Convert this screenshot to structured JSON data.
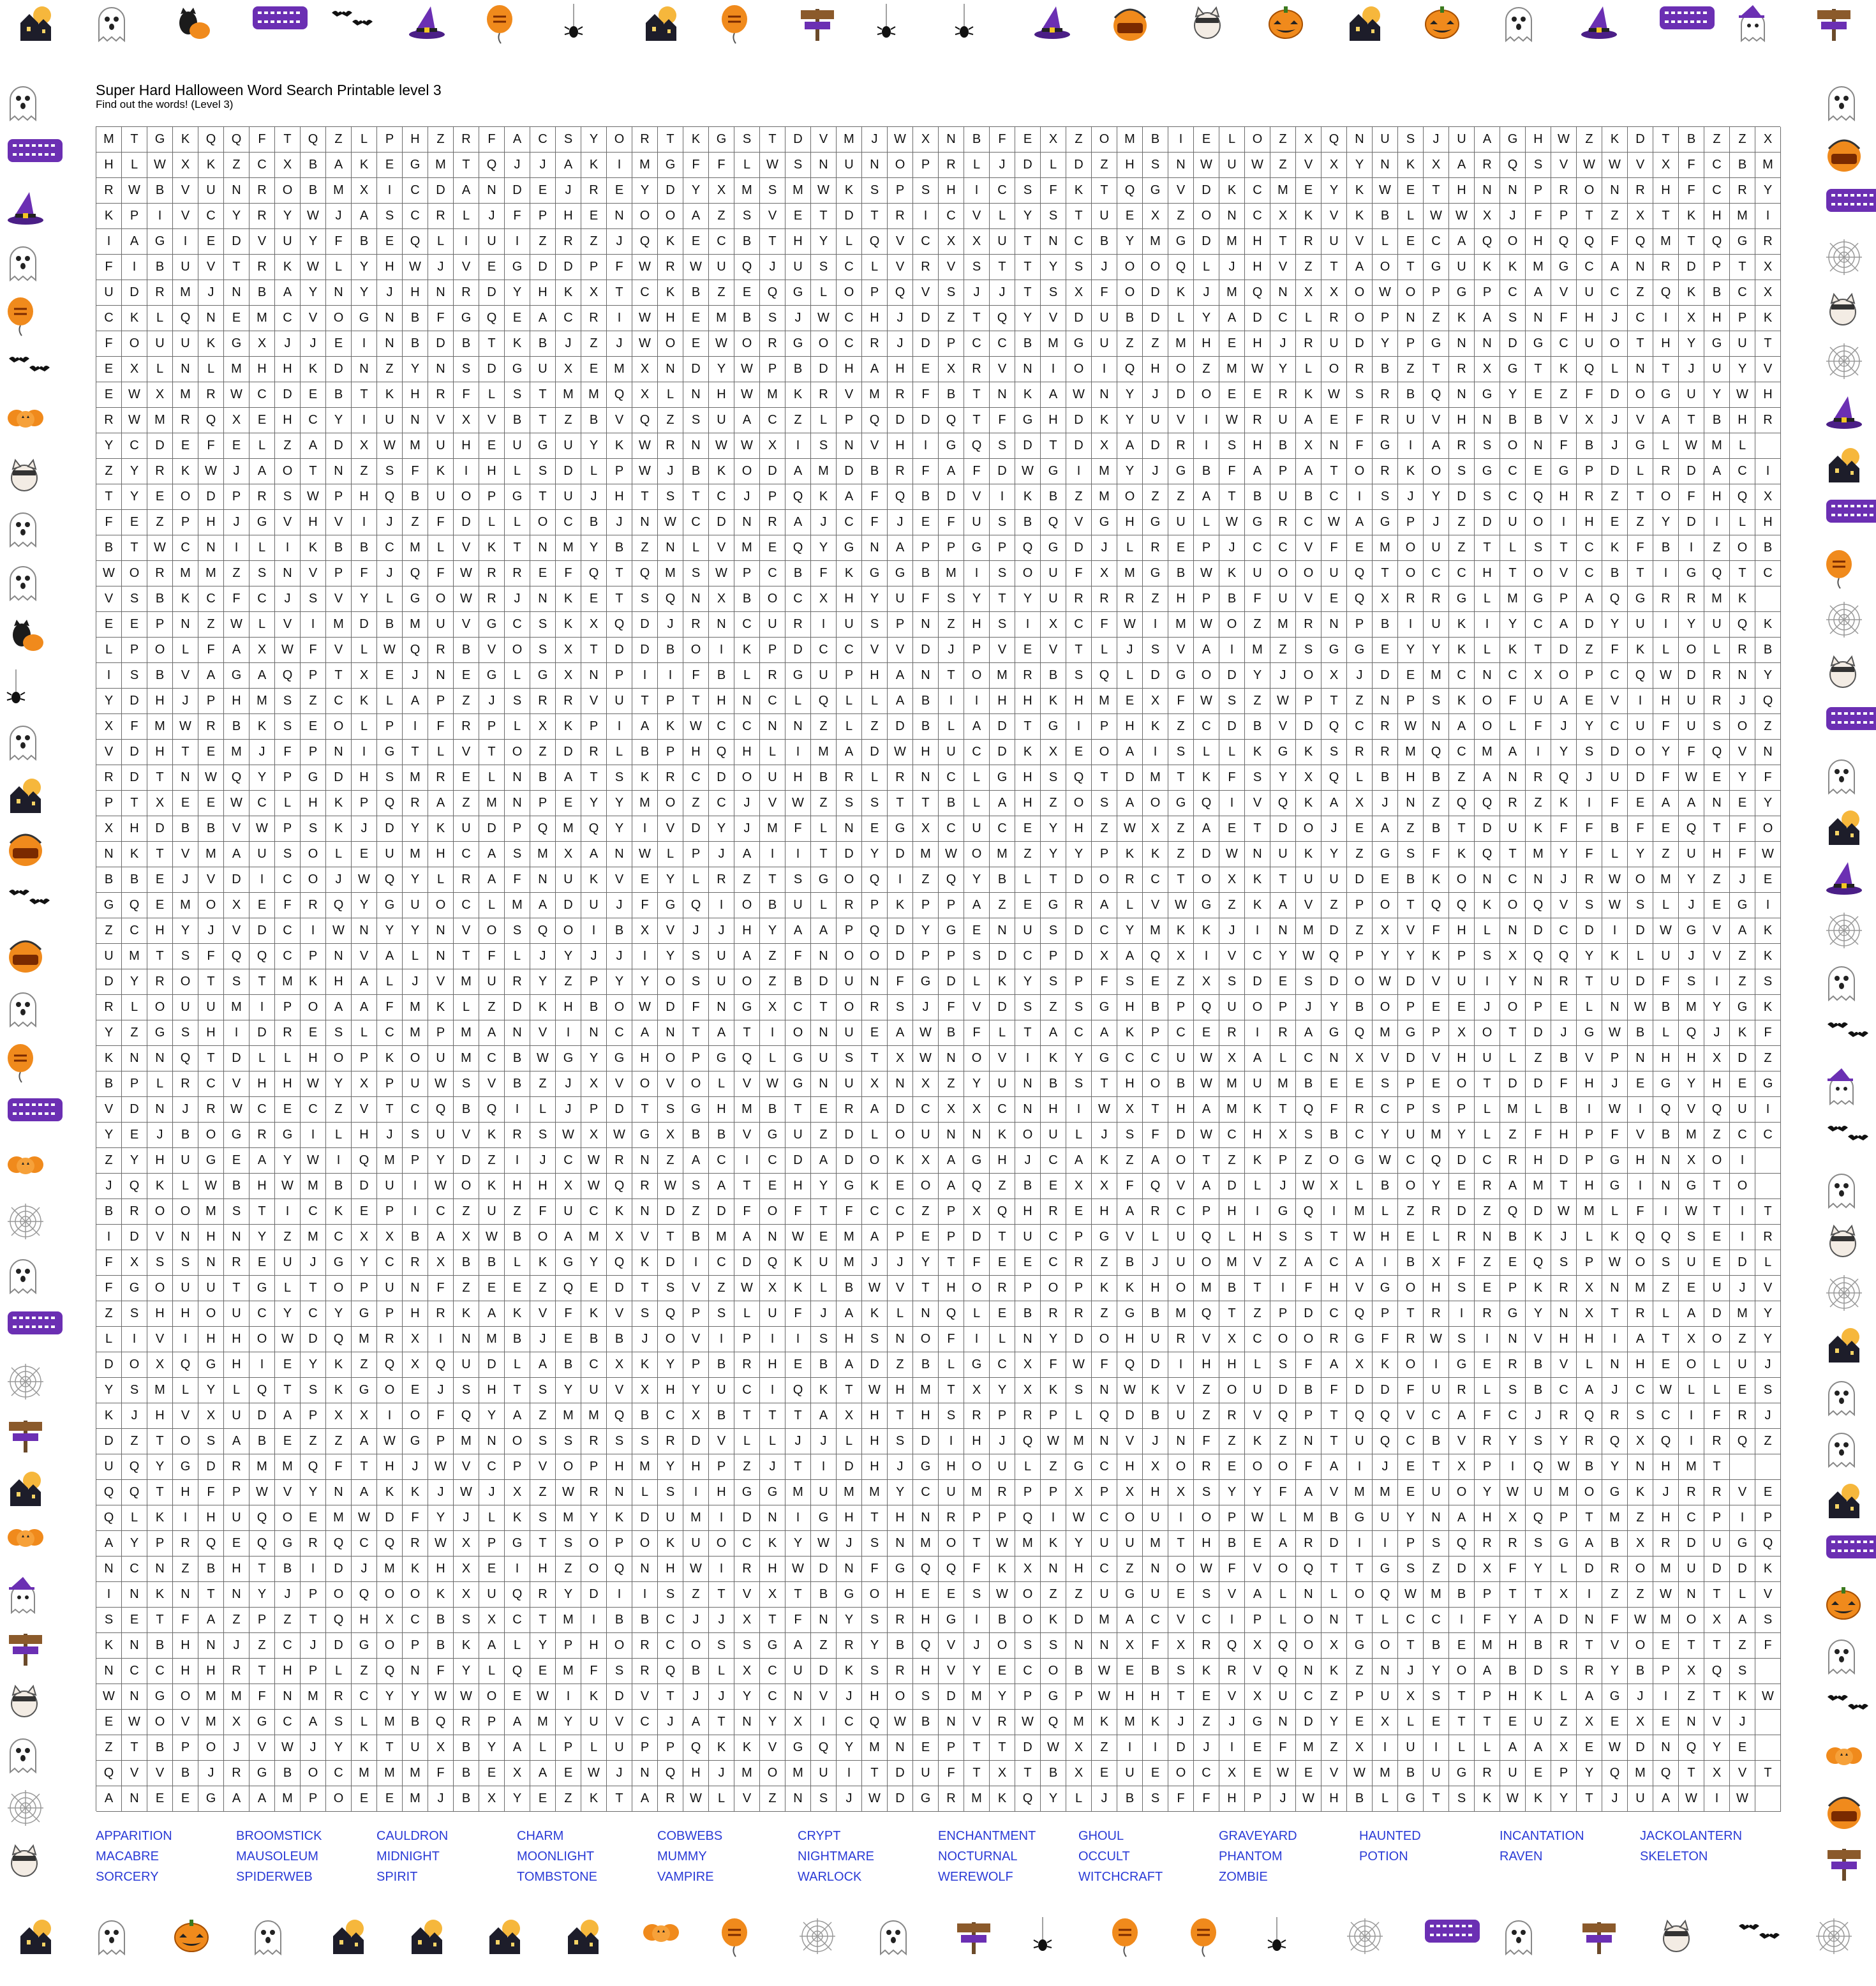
{
  "title": "Super Hard Halloween Word Search Printable level 3",
  "subtitle": "Find out the words! (Level 3)",
  "colors": {
    "word_list": "#2b3bd6",
    "grid_line": "#6a6a6a",
    "purple": "#6b2fb3",
    "orange": "#f08a1c"
  },
  "decorations": {
    "top": [
      "haunted-house-icon",
      "ghost-icon",
      "black-cat-pumpkin-icon",
      "happy-halloween-sign-icon",
      "bats-icon",
      "witch-hat-icon",
      "trick-or-treat-balloon-icon",
      "spider-icon",
      "haunted-house-icon",
      "trick-or-treat-balloon-icon",
      "halloween-signpost-icon",
      "spider-icon",
      "spider-icon",
      "witch-hat-icon",
      "trick-or-treat-bucket-icon",
      "cat-icon",
      "pumpkin-icon",
      "haunted-house-icon",
      "pumpkin-icon",
      "ghost-icon",
      "witch-hat-icon",
      "happy-halloween-sign-icon",
      "witch-ghost-icon",
      "halloween-signpost-icon"
    ],
    "bottom": [
      "haunted-house-icon",
      "ghost-icon",
      "pumpkin-icon",
      "ghost-icon",
      "haunted-house-icon",
      "haunted-house-icon",
      "haunted-house-icon",
      "haunted-house-icon",
      "pumpkins-icon",
      "trick-or-treat-balloon-icon",
      "spiderweb-icon",
      "ghost-icon",
      "halloween-signpost-icon",
      "spider-icon",
      "trick-or-treat-balloon-icon",
      "trick-or-treat-balloon-icon",
      "spider-icon",
      "spiderweb-icon",
      "happy-halloween-sign-icon",
      "ghost-icon",
      "halloween-signpost-icon",
      "cat-icon",
      "bats-icon",
      "spiderweb-icon"
    ],
    "left": [
      "ghost-icon",
      "happy-halloween-sign-icon",
      "witch-hat-icon",
      "ghost-icon",
      "trick-or-treat-balloon-icon",
      "bats-icon",
      "pumpkins-icon",
      "cat-icon",
      "ghost-icon",
      "ghost-icon",
      "black-cat-pumpkin-icon",
      "spider-icon",
      "ghost-icon",
      "haunted-house-icon",
      "trick-or-treat-bucket-icon",
      "bats-icon",
      "trick-or-treat-bucket-icon",
      "ghost-icon",
      "trick-or-treat-balloon-icon",
      "happy-halloween-sign-icon",
      "pumpkins-icon",
      "spiderweb-icon",
      "ghost-icon",
      "happy-halloween-sign-icon",
      "spiderweb-icon",
      "halloween-signpost-icon",
      "haunted-house-icon",
      "pumpkins-icon",
      "witch-ghost-icon",
      "halloween-signpost-icon",
      "cat-icon",
      "ghost-icon",
      "spiderweb-icon",
      "cat-icon"
    ],
    "right": [
      "ghost-icon",
      "trick-or-treat-bucket-icon",
      "happy-halloween-sign-icon",
      "spiderweb-icon",
      "cat-icon",
      "spiderweb-icon",
      "witch-hat-icon",
      "haunted-house-icon",
      "happy-halloween-sign-icon",
      "trick-or-treat-balloon-icon",
      "spiderweb-icon",
      "cat-icon",
      "happy-halloween-sign-icon",
      "ghost-icon",
      "haunted-house-icon",
      "witch-hat-icon",
      "spiderweb-icon",
      "ghost-icon",
      "bats-icon",
      "witch-ghost-icon",
      "bats-icon",
      "ghost-icon",
      "cat-icon",
      "spiderweb-icon",
      "haunted-house-icon",
      "ghost-icon",
      "ghost-icon",
      "haunted-house-icon",
      "happy-halloween-sign-icon",
      "pumpkin-icon",
      "ghost-icon",
      "bats-icon",
      "pumpkins-icon",
      "trick-or-treat-bucket-icon",
      "halloween-signpost-icon"
    ]
  },
  "grid": [
    "MTGKQQFTQZLPHZRFACSYORTKGSTDVMJWXNBFEXZOMBIELOZXQNUSJUAGHWZKDTBZZX",
    "HLWXKZCXBAKEGMTQJJAKIMGFFLWSNUNOPRLJDLDZHSNWUWZVXYNKXARQSVWWVXFCBM",
    "RWBVUNROBMXICDANDEJREYDYXMSMWKSPSHICSFKTQGVDKCMEYKWETHNNPRONRHFCRY",
    "KPIVCYRYWJASCRLJFPHENOOAZSVETDTRICVLYSTUEXZONCXKVKBLWWXJFPTZXTKHMI",
    "IAGIEDVUYFBEQLIUIZRZJQKECBTHYLQVCXXUTNCBYMGDMHTRUVLECAQOHQQFQMTQGR",
    "FIBUVTRKWLYHWJVEGDDPFWRWUQJUSCLVRVSTTYSJOOQLJHVZTAOTGUKKMGCANRDPTX",
    "UDRMJNBAYNYJHNRDYHKXTCKBZEQGLOPQVSJJTSXFODKJMQNXXOWOPGPCAVUCZQKBCX",
    "CKLQNEMCVOGNBFGQEACRIWHEMBSJWCHJDZTQYVDUBDLYADCLROPNZKASNFHJCIXHPK",
    "FOUUKGXJJEINBDBTKBJZJWOEWORGOCRJDPCCBMGUZZMHEHJRUDYPGNNDGCUOTHYGUT",
    "EXLNLMHHKDNZYNSDGUXEMXNDYWPBDHAHEXRVNIOIQHOZMWYLORBZTRXGTKQLNTJUYV",
    "EWXMRWCDEBTKHRFLSTMMQXLNHWMKRVMRFBTNKAWNYJDOEERKWSRBQNGYEZFDOGUYWH",
    "RWMRQXEHCYIUNVXVBTZBVQZSUACZLPQDDQTFGHDKYUVIWRUAEFRUVHNBBVXJVATBHR",
    "YCDEFELZADXWMUHEUGUYKWRNWWXISNVHIGQSDTDXADRISHBXNFGIARSONFBJGLWML",
    "ZYRKWJAOTNZSFKIHLSDLPWJBKODAMDBRFAFDWGIMYJGBFAPATORKOSGCEGPDLRDACI",
    "TYEODPRSWPHQBUOPGTUJHTSTCJPQKAFQBDVIKBZMOZZATBUBCISJYDSCQHRZTOFHQX",
    "FEZPHJGVHVIJZFDLLOCBJNWCDNRAJCFJEFUSBQVGHGULWGRCWAGPJZDUOIHEZYDILH",
    "BTWCNILIKBBCMLVKTNMYBZNLVMEQYGNAPPGPQGDJLREPJCCVFEMOUZTLSTCKFBIZOB",
    "WORMMZSNVPFJQFWRREFQTQMSWPCBFKGGBMISOUFXMGBWKUOOUQTOCCHTOVCBTIGQTC",
    "VSBKCFCJSVYLGOWRJNKETSQNXBOCXHYUFSYTYURRRZHPBFUVEQXRRGLMGPAQGRRMK",
    "EEPNZWLVIMDBMUVGCSKXQDJRNCURIUSPNZHSIXCFWIMWOZMRNPBIUKIYCADYUIYUQK",
    "LPOLFAXWFVLWQRBVOSXTDDBOIKPDCCVVDJPVEVTLJSVAIMZSGGEYYKLKTDZFKLOLRB",
    "ISBVAGAQPTXEJNEGLGXNPIIFBLRGUPHANTOMRBSQLDGODYJOXJDEMCNCXOPCQWDRNY",
    "YDHJPHMSZCKLAPZJSRRVUTPTHNCLQLLABIIHHKHMEXFWSZWPTZNPSKOFUAEVIHURJQ",
    "XFMWRBKSEOLPIFRPLXKPIAKWCCNNZLZDBLADTGIPHKZCDBVDQCRWNAOLFJYCUFUSOZ",
    "VDHTEMJFPNIGTLVTOZDRLBPHQHLIMADWHUCDKXEOAISLLKGKSRRMQCMAIYSDOYFQVN",
    "RDTNWQYPGDHSMRELNBATSKRCDOUHBRLRNCLGHSQTDMTKFSYXQLBHBZANRQJUDFWEYF",
    "PTXEEWCLHKPQRAZMNPEYYMOZCJVWZSSTTBLAHZOSAOGQIVQKAXJNZQQRZKIFEAANEY",
    "XHDBBVWPSKJDYKUDPQMQYIVDYJMFLNEGXCUCEYHZWXZAETDOJEAZBTDUKFFBFEQTFO",
    "NKTVMAUSOLEUMHCASMXANWLPJAIITDYDMWOMZYYPKKZDWNUKYZGSFKQTMYFLYZUHFW",
    "BBEJVDICOJWQYLRAFNUKVEYLRZTSGOQIZQYBLTDORCTOXKTUUDEBKONCNJRWOMYZJE",
    "GQEMOXEFRQYGUOCLMADUJFGQIOBULRPKPPAZEGRALVWGZKAVZPOTQQKOQVSWSLJEGI",
    "ZCHYJVDCIWNYYNVOSQOIBXVJJHYAAPQDYGENUSDCYMKKJINMDZXVFHLNDCDIDWGVAK",
    "UMTSFQQCPNVALNTFLJYJJIYSUAZFNOODPPSDCPDXAQXIVCYWQPYYKPSXQQYKLUJVZK",
    "DYROTSTMKHALJVMURYZPYYOSUOZBDUNFGDLKYSPFSEZXSDESDOWDVUIYNRTUDFSIZS",
    "RLOUUMIPOAAFMKLZDKHBOWDFNGXCTORSJFVDSZSGHBPQUOPJYBOPEEJOPELNWBMYGKCH",
    "YZGSHIDRESLCMPMANVINCANTATIONUEAWBFLTACAKPCERIRAGQMGPXOTDJGWBLQJKF",
    "KNNQTDLLHOPKOUMCBWGYGHOPGQLGUSTXWNOVIKYGCCUWXALCNXVDVHULZBVPNHHXDZ",
    "BPLRCVHHWYXPUWSVBZJXVOVOLVWGNUXNXZYUNBSTHOBWMUMBEESPEOTDDFHJEGYHEG",
    "VDNJRWCECZVTCQBQILJPDTSGHMBTERADCXXCNHIWXTHAMKTQFRCPSPLMLBIWIQVQUI",
    "YEJBOGRGILHJSUVKRSWXWGXBBVGUZDLOUNNKOULJSFDWCHXSBCYUMYLZFHPFVBMZCC",
    "ZYHUGEAYWIQMPYDZIJCWRNZACICDADOKXAGHJCAKZAOTZKPZOGWCQDCRHDPGHNXOI",
    "JQKLWBHWMBDUIWOKHHXWQRWSATEHYGKEOAQZBEXXFQVADLJWXLBOYERAMTHGINGTO",
    "BROOMSTICKEPICZUZFUCKNDZDFOFTFCCZPXQHREHARCPHIGQIMLZRDZQDWMLFIWTIT",
    "IDVNHNYZMCXXBAXWBOAMXVTBMANWEMAPEPDTUCPGVLUQLHSSTWHELRNBKJLKQQSEIR",
    "FXSSNREUJGYCRXBBLKGYQKDICDQKUMJJYTFEECRZBJUOMVZACAIBXFZEQSPWOSUEDL",
    "FGOUUTGLTOPUNFZEEZQEDTSVZWXKLBWVTHORPOPKKHOMBTIFHVGOHSEPKRXNMZEUJV",
    "ZSHHOUCYCYGPHRKAKVFKVSQPSLUFJAKLNQLEBRRZGBMQTZPDCQPTRIRGYNXTRLADMY",
    "LIVIHHOWDQMRXINMBJEBBJOVIPIISHSNOFILNYDOHURVXCOORGFRWSINVHHIATXOZY",
    "DOXQGHIEYKZQXQUDLABCXKYPBRHEBADZBLGCXFWFQDIHHLSFAXKOIGERBVLNHEOLUJ",
    "YSMLYLQTSKGOEJSHTSYUVXHYUCIQKTWHMTXYXKSNWKVZOUDBFDDFURLSBCAJCWLLES",
    "KJHVXUDAPXXIOFQYAZMMQBCXBTTTAXHTHSRPRPLQDBUZRVQPTQQVCAFCJRQRSCIFRJ",
    "DZTOSABEZZAWGPMNOSSRSSRDVLLJJLHSDIHJQWMNVJNFZKZNTUQCBVRYSYRQXQIRQZ",
    "UQYGDRMMQFTHJWVCPVOPHMYHPZJTIDHJGHOULZGCHXOREOOFAIJETXPIQWBYNHMT",
    "QQTHFPWVYNAKKJWJXZWRNLSIHGGMUMMYCUMRPPXPXHXSYYFAVMMEUOYWUMOGKJRRVEE",
    "QLKIHUQOEMWDFYJLKSMYKDUMIDNIGHTHNRPPQIWCOUIOPWLMBGUYNAHXQPTMZHCPIP",
    "AYPRQEQGRQCQRWXPGTSOPOKUOCKYWJSNMOTWMKYUUMTHBEARDIIPSQRRSGABXRDUGQDE",
    "NCNZBHTBIDJMKHXEIHZOQNHWIRHWDNFGQQFKXNHCZNOWFVOQTTGSZDXFYLDROMUDDK",
    "INKNTNYJPOQOOKXUQRYDIISZTVXTBGOHEESWOZZUGUESVALNLOQWMBPTTXIZZWNTLV",
    "SETFAZPZTQHXCBSXCTMIBBCJJXTFNYSRHGIBOKDMACVCIPLONTLCCIFYADNFWMOXAS",
    "KNBHNJZCJDGOPBKALYPHORCOSSGAZRYBQVJOSSNNXFXRQXQOXGOTBEMHBRTVOETTZFSVEMLV",
    "NCCHHRTHPLZQNFYLQEMFSRQBLXCUDKSRHVYECOBWEBSKRVQNKZNJYOABDSRYBPXQS",
    "WNGOMMFNMRCYYWWOEWIKDVTJJYCNVJHOSDMYPGPWHHTEVXUCZPUXSTPHKLAGJIZTKW",
    "EWOVMXGCASLMBQRPAMYUVCJATNYXICQWBNVRWQMKMKJZJGNDYEXLETTEUZXEXENVJ",
    "ZTBPOJVWJYKTUXBYALPLUPPQKKVGQYMNEPTTDWXZIIDJIEFMZXIUILLAAXEWDNQYE",
    "QVVBJRGBOCMMMFBEXAEWJNQHJMOMUITDUFTXTBXEUEOCXEWEVWMBUGRUEPYQMQTXVTXI",
    "ANEEGAAMPOEEMJBXYEZKTARWLVZNSJWDGRMKQYLJBSFFHPJWHBLGTSKWKYTJUAWIW"
  ],
  "word_list": [
    "APPARITION",
    "BROOMSTICK",
    "CAULDRON",
    "CHARM",
    "COBWEBS",
    "CRYPT",
    "ENCHANTMENT",
    "GHOUL",
    "GRAVEYARD",
    "HAUNTED",
    "INCANTATION",
    "JACKOLANTERN",
    "MACABRE",
    "MAUSOLEUM",
    "MIDNIGHT",
    "MOONLIGHT",
    "MUMMY",
    "NIGHTMARE",
    "NOCTURNAL",
    "OCCULT",
    "PHANTOM",
    "POTION",
    "RAVEN",
    "SKELETON",
    "SORCERY",
    "SPIDERWEB",
    "SPIRIT",
    "TOMBSTONE",
    "VAMPIRE",
    "WARLOCK",
    "WEREWOLF",
    "WITCHCRAFT",
    "ZOMBIE"
  ]
}
